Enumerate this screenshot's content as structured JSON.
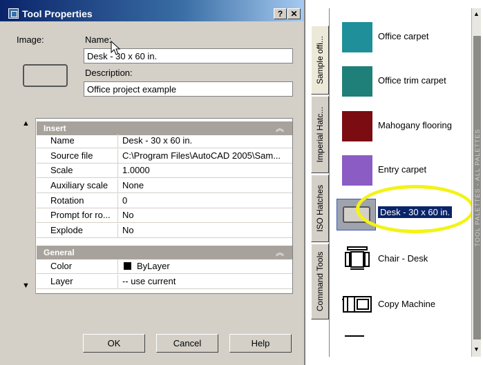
{
  "dialog": {
    "title": "Tool Properties",
    "help_button": "?",
    "close_button": "✕",
    "image_label": "Image:",
    "name_label": "Name:",
    "name_value": "Desk - 30 x 60 in.",
    "description_label": "Description:",
    "description_value": "Office project example",
    "categories": [
      {
        "name": "Insert",
        "collapse": "︽",
        "rows": [
          {
            "name": "Name",
            "value": "Desk - 30 x 60 in."
          },
          {
            "name": "Source file",
            "value": "C:\\Program Files\\AutoCAD 2005\\Sam..."
          },
          {
            "name": "Scale",
            "value": "1.0000"
          },
          {
            "name": "Auxiliary scale",
            "value": "None"
          },
          {
            "name": "Rotation",
            "value": "0"
          },
          {
            "name": "Prompt for ro...",
            "value": "No"
          },
          {
            "name": "Explode",
            "value": "No"
          }
        ]
      },
      {
        "name": "General",
        "collapse": "︽",
        "rows": [
          {
            "name": "Color",
            "value": "ByLayer"
          },
          {
            "name": "Layer",
            "value": "-- use current"
          }
        ]
      }
    ],
    "buttons": {
      "ok": "OK",
      "cancel": "Cancel",
      "help": "Help"
    }
  },
  "palette": {
    "tabs": [
      "Sample offi...",
      "Imperial Hatc...",
      "ISO Hatches",
      "Command Tools"
    ],
    "active_tab": "Sample offi...",
    "items": [
      {
        "name": "Office carpet",
        "color": "#1f8f99",
        "icon": "swatch-icon"
      },
      {
        "name": "Office trim carpet",
        "color": "#1e8078",
        "icon": "swatch-icon"
      },
      {
        "name": "Mahogany flooring",
        "color": "#7b0c12",
        "icon": "swatch-icon"
      },
      {
        "name": "Entry carpet",
        "color": "#8b5cc4",
        "icon": "swatch-icon"
      },
      {
        "name": "Desk - 30 x 60 in.",
        "icon": "desk-block-icon",
        "selected": true
      },
      {
        "name": "Chair - Desk",
        "icon": "chair-icon"
      },
      {
        "name": "Copy Machine",
        "icon": "copy-machine-icon"
      }
    ],
    "strip_title": "TOOL PALETTES - ALL PALETTES"
  }
}
